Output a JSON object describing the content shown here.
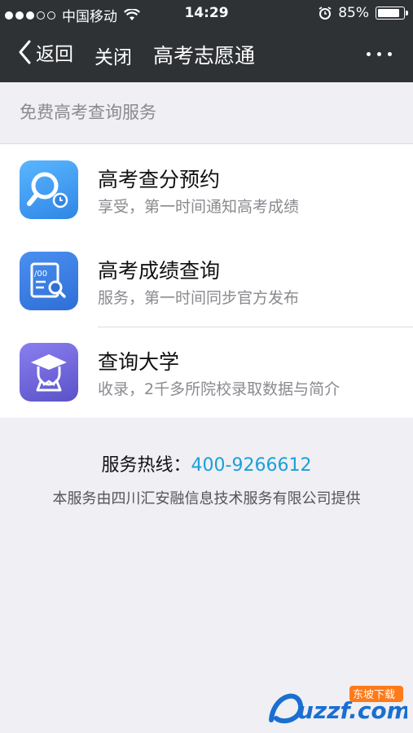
{
  "status_bar": {
    "carrier": "中国移动",
    "time": "14:29",
    "battery": "85%",
    "battery_level": 0.85,
    "signal_bars_filled": 3,
    "signal_bars_total": 5
  },
  "navbar": {
    "back_label": "返回",
    "close_label": "关闭",
    "title": "高考志愿通"
  },
  "section_label": "免费高考查询服务",
  "services": [
    {
      "title": "高考查分预约",
      "subtitle": "享受，第一时间通知高考成绩",
      "icon": "magnifier-clock-icon",
      "color": "#3e9cf0"
    },
    {
      "title": "高考成绩查询",
      "subtitle": "服务，第一时间同步官方发布",
      "icon": "score-sheet-icon",
      "color": "#3d7fe0"
    },
    {
      "title": "查询大学",
      "subtitle": "收录，2千多所院校录取数据与简介",
      "icon": "graduation-cap-icon",
      "color": "#6b62d6"
    }
  ],
  "footer": {
    "hotline_label": "服务热线：",
    "hotline_number": "400-9266612",
    "provider": "本服务由四川汇安融信息技术服务有限公司提供"
  },
  "watermark": {
    "text": "uzzf.com",
    "badge": "东坡下载"
  },
  "colors": {
    "navbar_bg": "#2f3235",
    "page_bg": "#efeff4",
    "link_blue": "#1aa0d8"
  }
}
